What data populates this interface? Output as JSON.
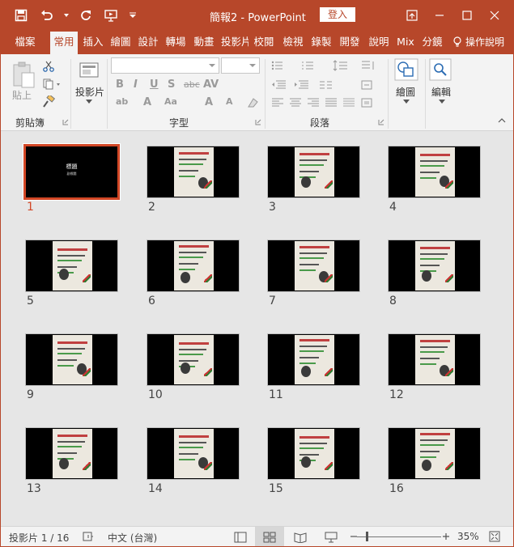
{
  "titlebar": {
    "title": "簡報2  -  PowerPoint",
    "signin_label": "登入",
    "qat_icons": [
      "save-icon",
      "undo-icon",
      "redo-icon",
      "present-icon",
      "customize-icon"
    ]
  },
  "tabs": [
    {
      "label": "檔案",
      "active": false
    },
    {
      "label": "常用",
      "active": true
    },
    {
      "label": "插入",
      "active": false
    },
    {
      "label": "繪圖",
      "active": false
    },
    {
      "label": "設計",
      "active": false
    },
    {
      "label": "轉場",
      "active": false
    },
    {
      "label": "動畫",
      "active": false
    },
    {
      "label": "投影片",
      "active": false
    },
    {
      "label": "校閱",
      "active": false
    },
    {
      "label": "檢視",
      "active": false
    },
    {
      "label": "錄製",
      "active": false
    },
    {
      "label": "開發",
      "active": false
    },
    {
      "label": "說明",
      "active": false
    },
    {
      "label": "Mix",
      "active": false
    },
    {
      "label": "分鏡",
      "active": false
    }
  ],
  "tell_me": "操作說明",
  "ribbon": {
    "clipboard": {
      "label": "剪貼簿",
      "paste": "貼上"
    },
    "slides": {
      "new_slide": "投影片"
    },
    "font": {
      "label": "字型"
    },
    "paragraph": {
      "label": "段落"
    },
    "drawing": {
      "label": "繪圖"
    },
    "editing": {
      "label": "編輯"
    }
  },
  "slides": [
    {
      "number": "1",
      "selected": true,
      "title": "標題",
      "subtitle": "副標題"
    },
    {
      "number": "2",
      "selected": false
    },
    {
      "number": "3",
      "selected": false
    },
    {
      "number": "4",
      "selected": false
    },
    {
      "number": "5",
      "selected": false
    },
    {
      "number": "6",
      "selected": false
    },
    {
      "number": "7",
      "selected": false
    },
    {
      "number": "8",
      "selected": false
    },
    {
      "number": "9",
      "selected": false
    },
    {
      "number": "10",
      "selected": false
    },
    {
      "number": "11",
      "selected": false
    },
    {
      "number": "12",
      "selected": false
    },
    {
      "number": "13",
      "selected": false
    },
    {
      "number": "14",
      "selected": false
    },
    {
      "number": "15",
      "selected": false
    },
    {
      "number": "16",
      "selected": false
    }
  ],
  "status": {
    "slide_count": "投影片 1 / 16",
    "language": "中文 (台灣)",
    "zoom": "35%",
    "zoom_fraction": 0.11
  },
  "colors": {
    "accent": "#b7472a",
    "selection": "#d24726"
  }
}
